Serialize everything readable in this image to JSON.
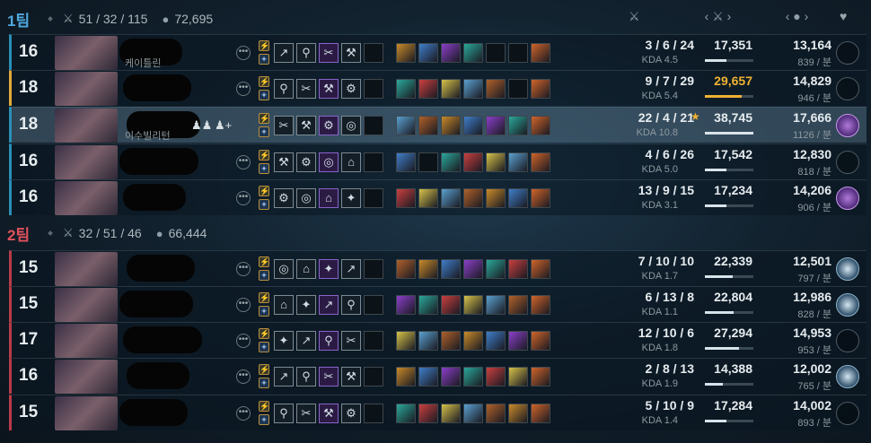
{
  "columns": {
    "kda_icon": "⚔",
    "damage_label": "‹ ⚔ ›",
    "gold_label": "‹ ● ›",
    "badge_icon": "♥"
  },
  "teams": [
    {
      "name": "1팀",
      "color": "#4fa9e0",
      "score": "51 / 32 / 115",
      "gold": "72,695",
      "accent": "#2a8fb5"
    },
    {
      "name": "2팀",
      "color": "#e0515b",
      "score": "32 / 51 / 46",
      "gold": "66,444",
      "accent": "#b83b48"
    }
  ],
  "players": [
    {
      "level": "16",
      "name": "케이틀린",
      "kda": "3 / 6 / 24",
      "kda_ratio": "KDA 4.5",
      "damage": "17,351",
      "damage_frac": 0.45,
      "gold": "13,164",
      "gpm": "839 / 분",
      "badge": "none",
      "self": false,
      "gold_dmg": false
    },
    {
      "level": "18",
      "name": "",
      "kda": "9 / 7 / 29",
      "kda_ratio": "KDA 5.4",
      "damage": "29,657",
      "damage_frac": 0.75,
      "gold": "14,829",
      "gpm": "946 / 분",
      "badge": "none",
      "self": false,
      "gold_dmg": true
    },
    {
      "level": "18",
      "name": "이수빌리턴",
      "kda": "22 / 4 / 21",
      "kda_ratio": "KDA 10.8",
      "damage": "38,745",
      "damage_frac": 1.0,
      "gold": "17,666",
      "gpm": "1126 / 분",
      "badge": "purple",
      "self": true,
      "gold_dmg": false
    },
    {
      "level": "16",
      "name": "",
      "kda": "4 / 6 / 26",
      "kda_ratio": "KDA 5.0",
      "damage": "17,542",
      "damage_frac": 0.45,
      "gold": "12,830",
      "gpm": "818 / 분",
      "badge": "none",
      "self": false,
      "gold_dmg": false
    },
    {
      "level": "16",
      "name": "",
      "kda": "13 / 9 / 15",
      "kda_ratio": "KDA 3.1",
      "damage": "17,234",
      "damage_frac": 0.44,
      "gold": "14,206",
      "gpm": "906 / 분",
      "badge": "purple",
      "self": false,
      "gold_dmg": false
    },
    {
      "level": "15",
      "name": "",
      "kda": "7 / 10 / 10",
      "kda_ratio": "KDA 1.7",
      "damage": "22,339",
      "damage_frac": 0.58,
      "gold": "12,501",
      "gpm": "797 / 분",
      "badge": "blue",
      "self": false,
      "gold_dmg": false
    },
    {
      "level": "15",
      "name": "",
      "kda": "6 / 13 / 8",
      "kda_ratio": "KDA 1.1",
      "damage": "22,804",
      "damage_frac": 0.59,
      "gold": "12,986",
      "gpm": "828 / 분",
      "badge": "blue",
      "self": false,
      "gold_dmg": false
    },
    {
      "level": "17",
      "name": "",
      "kda": "12 / 10 / 6",
      "kda_ratio": "KDA 1.8",
      "damage": "27,294",
      "damage_frac": 0.7,
      "gold": "14,953",
      "gpm": "953 / 분",
      "badge": "none",
      "self": false,
      "gold_dmg": false
    },
    {
      "level": "16",
      "name": "",
      "kda": "2 / 8 / 13",
      "kda_ratio": "KDA 1.9",
      "damage": "14,388",
      "damage_frac": 0.37,
      "gold": "12,002",
      "gpm": "765 / 분",
      "badge": "blue",
      "self": false,
      "gold_dmg": false
    },
    {
      "level": "15",
      "name": "",
      "kda": "5 / 10 / 9",
      "kda_ratio": "KDA 1.4",
      "damage": "17,284",
      "damage_frac": 0.45,
      "gold": "14,002",
      "gpm": "893 / 분",
      "badge": "none",
      "self": false,
      "gold_dmg": false
    }
  ],
  "colors": {
    "item_palette": [
      "#c98a2a",
      "#3f7ec9",
      "#8b3fc9",
      "#2aa89a",
      "#c93f3f",
      "#d6c24a",
      "#5aa0d0",
      "#b0612a"
    ]
  }
}
